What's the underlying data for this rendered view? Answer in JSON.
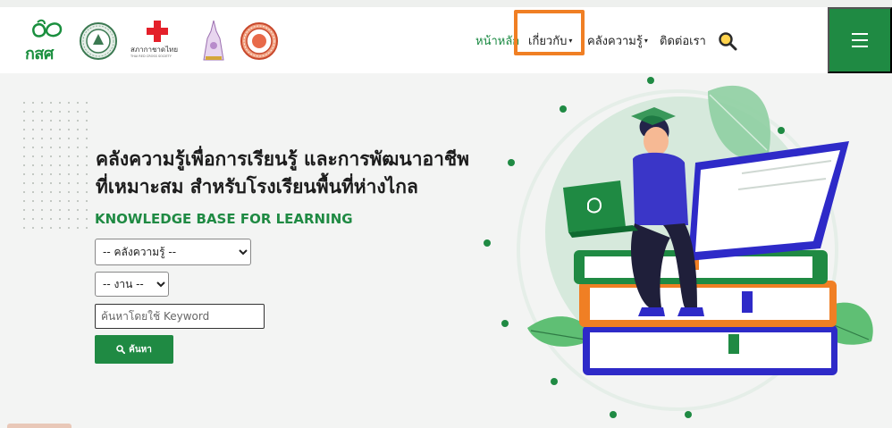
{
  "header": {
    "brand_text": "กสศ",
    "redcross_text": "สภากาชาดไทย",
    "redcross_subtext": "THAI RED CROSS SOCIETY",
    "nav": [
      {
        "label": "หน้าหลัก",
        "active": true,
        "has_caret": false
      },
      {
        "label": "เกี่ยวกับ",
        "active": false,
        "has_caret": true
      },
      {
        "label": "คลังความรู้",
        "active": false,
        "has_caret": true
      },
      {
        "label": "ติดต่อเรา",
        "active": false,
        "has_caret": false
      }
    ],
    "caret_glyph": "▾",
    "search_icon": "search-icon",
    "menu_icon": "hamburger-icon"
  },
  "hero": {
    "title_line1": "คลังความรู้เพื่อการเรียนรู้ และการพัฒนาอาชีพ",
    "title_line2": "ที่เหมาะสม สำหรับโรงเรียนพื้นที่ห่างไกล",
    "subtitle": "KNOWLEDGE BASE FOR LEARNING"
  },
  "form": {
    "category_selected": "-- คลังความรู้ --",
    "work_selected": "-- งาน --",
    "keyword_placeholder": "ค้นหาโดยใช้ Keyword",
    "keyword_value": "",
    "search_label": "ค้นหา"
  },
  "colors": {
    "brand_green": "#1f8a43",
    "highlight_orange": "#f07f24",
    "page_bg": "#f3f4f3"
  }
}
